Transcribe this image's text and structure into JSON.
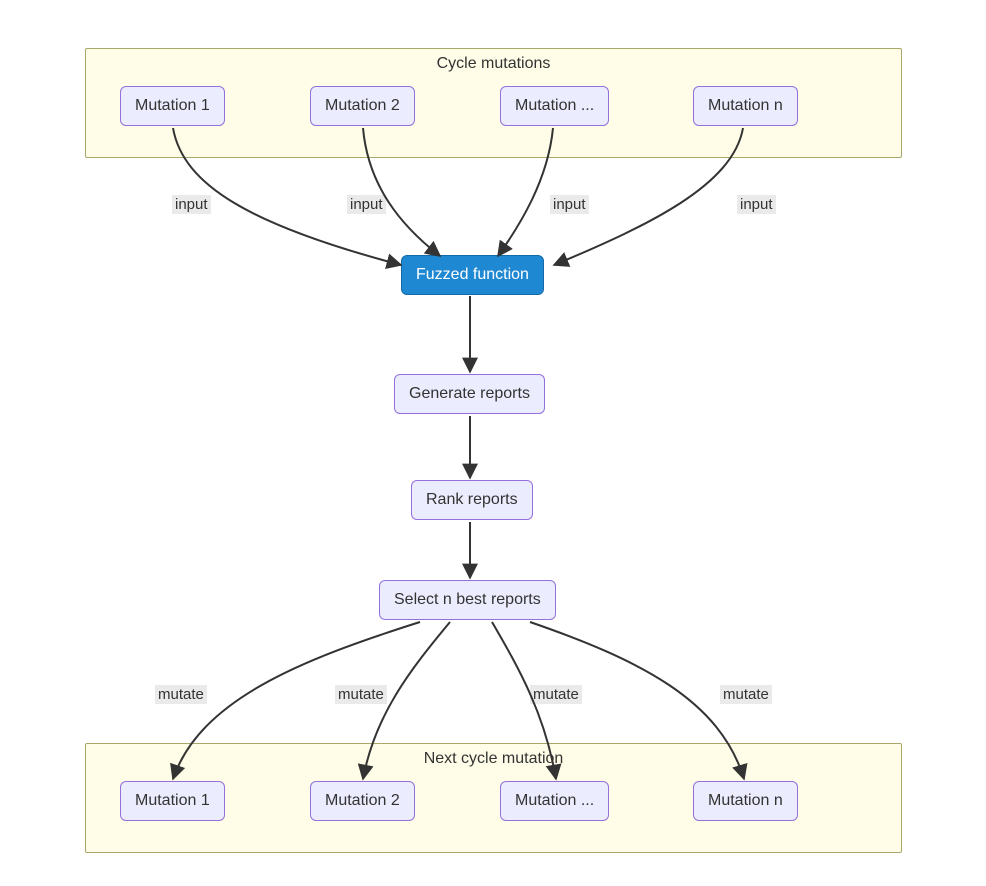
{
  "groups": {
    "top": {
      "title": "Cycle mutations"
    },
    "bottom": {
      "title": "Next cycle mutation"
    }
  },
  "nodes": {
    "m1": "Mutation 1",
    "m2": "Mutation 2",
    "mdots": "Mutation ...",
    "mn": "Mutation n",
    "fuzz": "Fuzzed function",
    "gen": "Generate reports",
    "rank": "Rank reports",
    "select": "Select n best reports",
    "b1": "Mutation 1",
    "b2": "Mutation 2",
    "bdots": "Mutation ...",
    "bn": "Mutation n"
  },
  "edges": {
    "input": "input",
    "mutate": "mutate"
  }
}
